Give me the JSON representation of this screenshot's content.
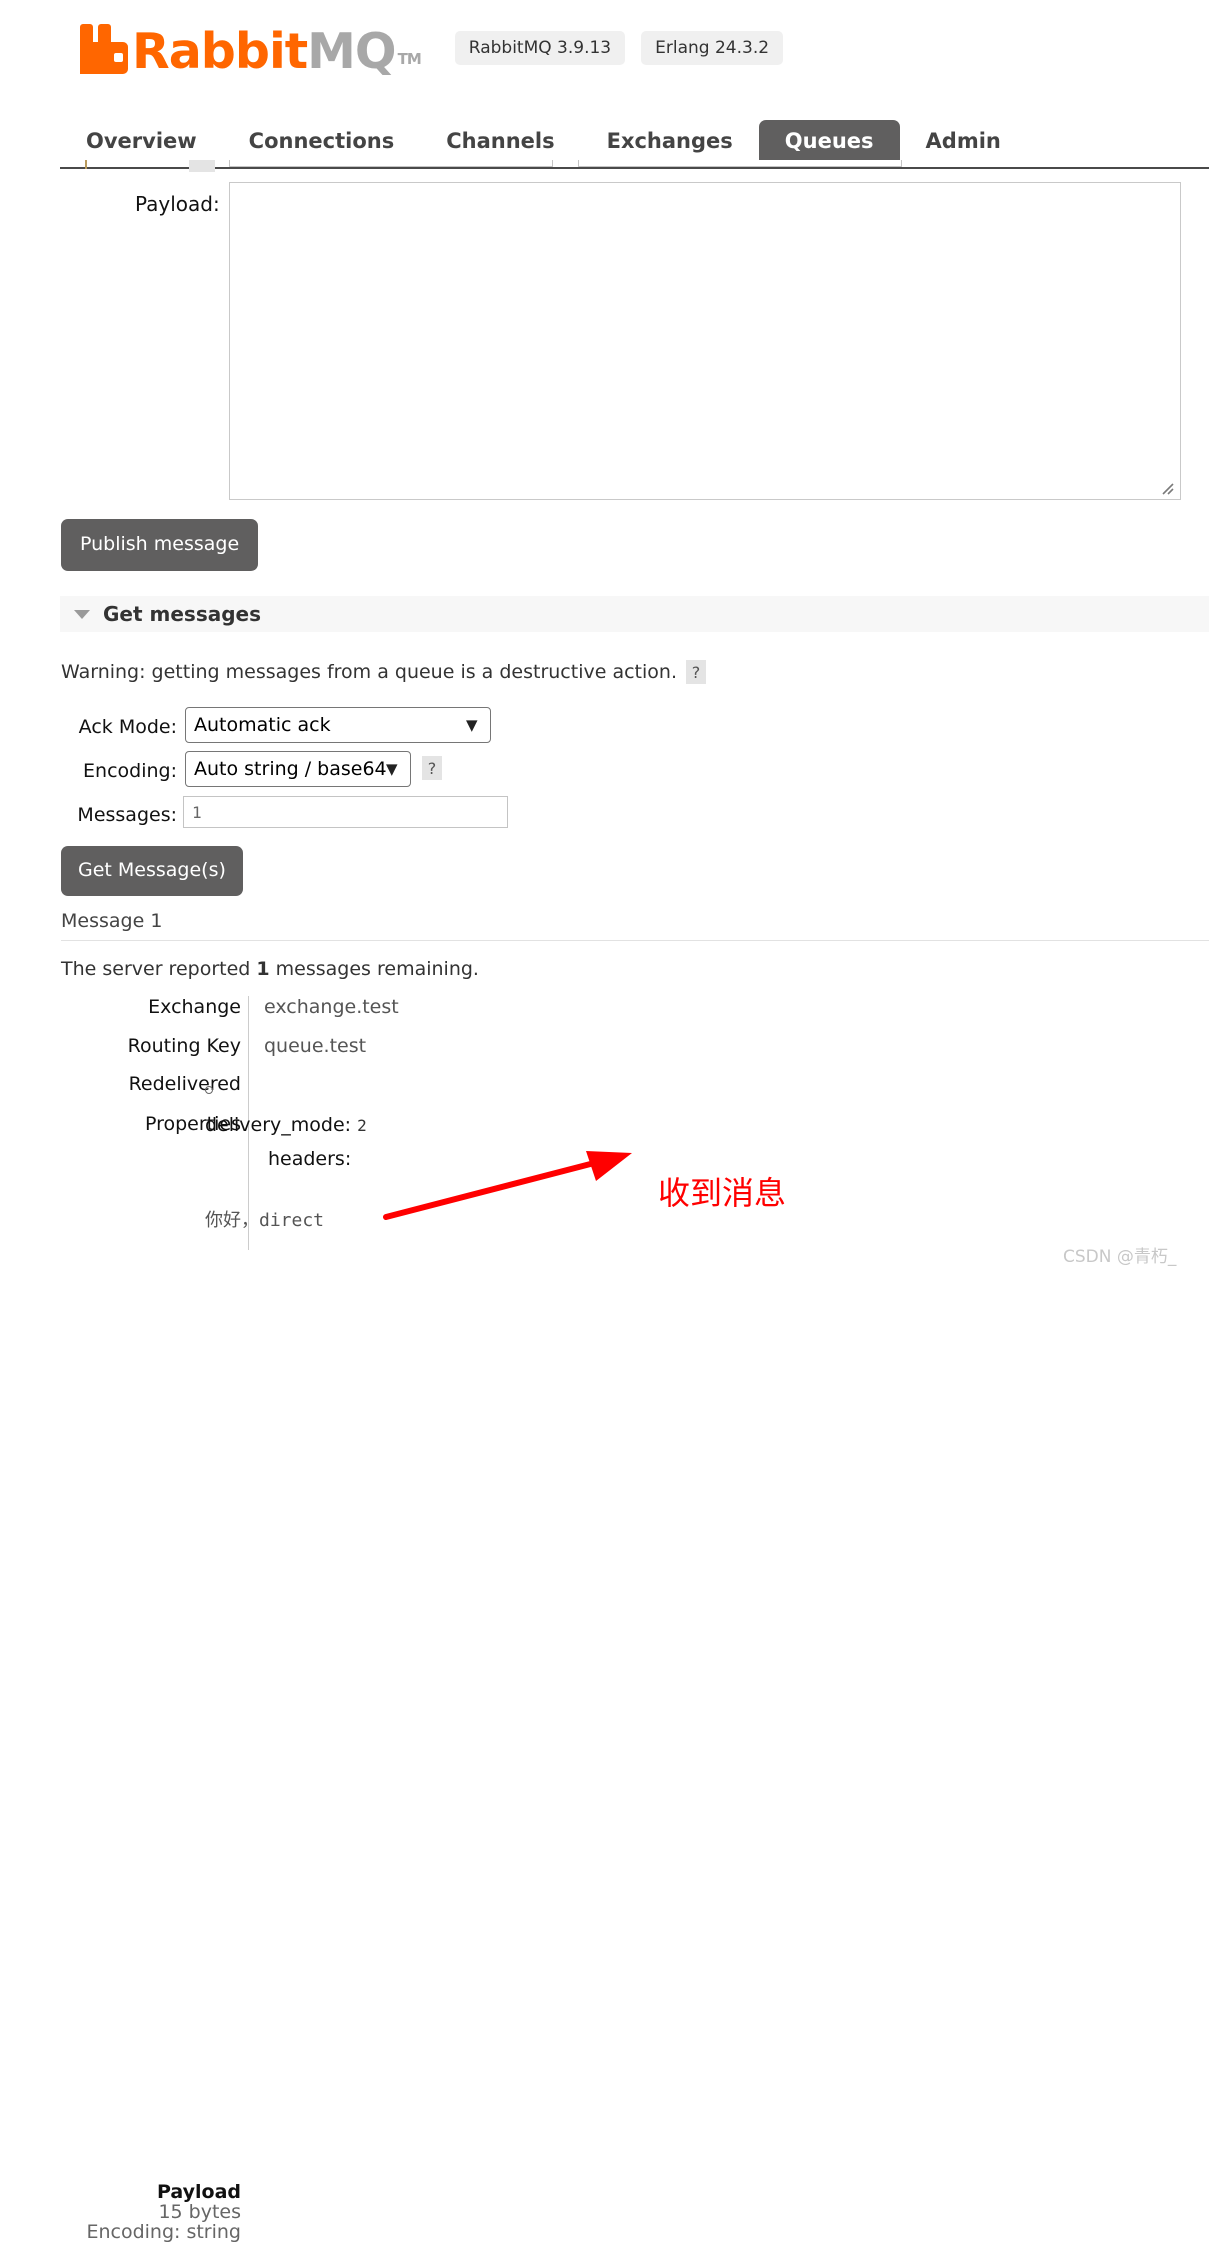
{
  "header": {
    "logo_text_primary": "Rabbit",
    "logo_text_secondary": "MQ",
    "logo_tm": "TM",
    "version_pills": [
      {
        "label": "RabbitMQ 3.9.13"
      },
      {
        "label": "Erlang 24.3.2"
      }
    ]
  },
  "nav": {
    "tabs": [
      {
        "label": "Overview",
        "active": false
      },
      {
        "label": "Connections",
        "active": false
      },
      {
        "label": "Channels",
        "active": false
      },
      {
        "label": "Exchanges",
        "active": false
      },
      {
        "label": "Queues",
        "active": true
      },
      {
        "label": "Admin",
        "active": false
      }
    ]
  },
  "publish": {
    "payload_label": "Payload:",
    "payload_value": "",
    "publish_button": "Publish message"
  },
  "get_messages": {
    "section_title": "Get messages",
    "warning_text": "Warning: getting messages from a queue is a destructive action.",
    "warning_help": "?",
    "ack_mode_label": "Ack Mode:",
    "ack_mode_value": "Automatic ack",
    "ack_mode_options": [
      "Automatic ack"
    ],
    "encoding_label": "Encoding:",
    "encoding_value": "Auto string / base64",
    "encoding_options": [
      "Auto string / base64"
    ],
    "encoding_help": "?",
    "messages_label": "Messages:",
    "messages_value": "1",
    "get_button": "Get Message(s)"
  },
  "message": {
    "title": "Message 1",
    "server_report_prefix": "The server reported ",
    "server_report_count": "1",
    "server_report_suffix": " messages remaining.",
    "rows": [
      {
        "key": "Exchange",
        "value": "exchange.test"
      },
      {
        "key": "Routing Key",
        "value": "queue.test"
      },
      {
        "key": "Redelivered",
        "value": "○"
      },
      {
        "key": "Properties",
        "value": ""
      }
    ],
    "properties": {
      "delivery_mode_key": "delivery_mode:",
      "delivery_mode_value": "2",
      "headers_key": "headers:"
    },
    "payload": {
      "key": "Payload",
      "bytes": "15 bytes",
      "encoding": "Encoding: string",
      "value": "你好，direct"
    }
  },
  "annotation": {
    "text": "收到消息",
    "color": "#ff0000"
  },
  "watermark": {
    "text": "CSDN @青朽_"
  },
  "colors": {
    "brand_orange": "#ff6600",
    "tab_active_bg": "#605f5f",
    "button_bg": "#605f5f",
    "section_bg": "#f7f7f7"
  }
}
